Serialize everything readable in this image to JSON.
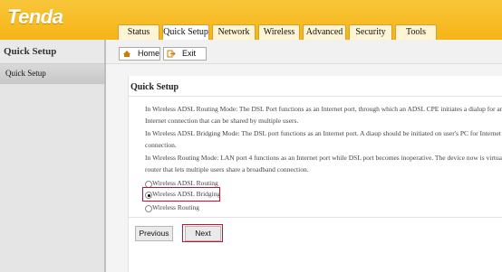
{
  "brand": {
    "logo": "Tenda"
  },
  "nav_tabs": [
    "Status",
    "Quick Setup",
    "Network",
    "Wireless",
    "Advanced",
    "Security",
    "Tools"
  ],
  "active_tab": "Quick Setup",
  "sidebar": {
    "title": "Quick Setup",
    "items": [
      {
        "label": "Quick Setup"
      }
    ]
  },
  "toolbar": {
    "home_label": "Home",
    "exit_label": "Exit"
  },
  "main": {
    "title": "Quick Setup",
    "descriptions": [
      "In Wireless ADSL Routing Mode: The DSL Port functions as an Internet port, through which an ADSL CPE initiates a dialup for an",
      "Internet connection that can be shared by multiple users.",
      "In Wireless ADSL Bridging Mode: The DSL port functions as an Internet port. A diaup should be initiated on user's PC for Internet",
      "connection.",
      "In Wireless Routing Mode: LAN port 4 functions as an Internet port while DSL port becomes inoperative. The device now is virtually a",
      "router that lets multiple users share a broadband connection."
    ],
    "options": [
      {
        "label": "Wireless ADSL Routing",
        "selected": false
      },
      {
        "label": "Wireless ADSL Bridging",
        "selected": true
      },
      {
        "label": "Wireless Routing",
        "selected": false
      }
    ],
    "previous_label": "Previous",
    "next_label": "Next"
  },
  "colors": {
    "header": "#f6b417",
    "highlight": "#c8102e"
  }
}
